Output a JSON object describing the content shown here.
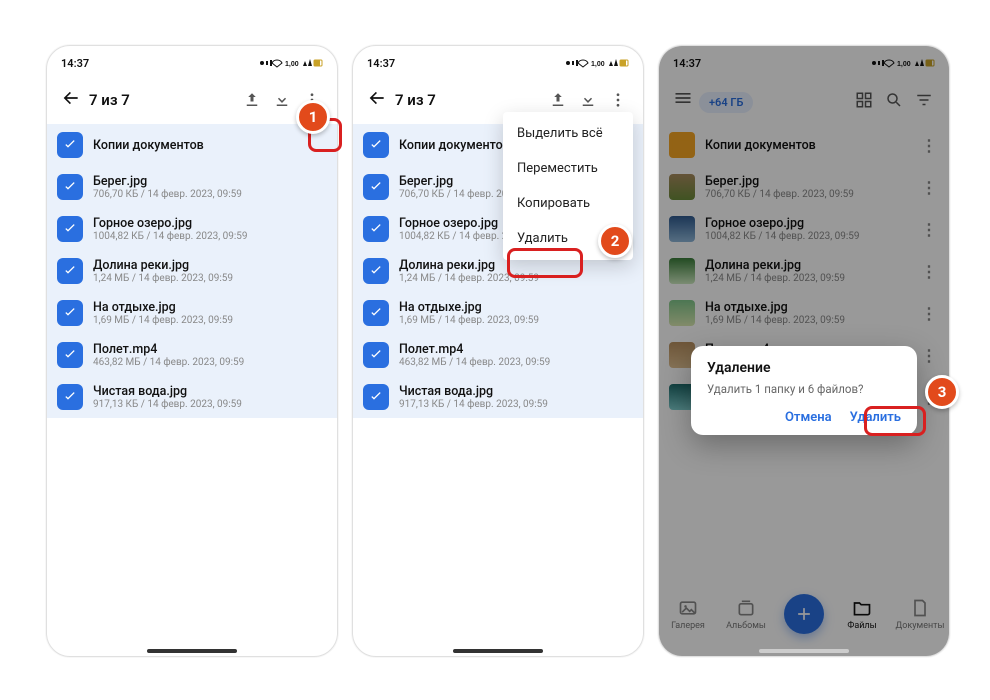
{
  "status_time": "14:37",
  "selection_title": "7 из 7",
  "chip_label": "+64 ГБ",
  "folder": {
    "name": "Копии документов"
  },
  "files": [
    {
      "name": "Берег.jpg",
      "meta": "706,70 КБ / 14 февр. 2023, 09:59",
      "thumb": "linear-gradient(#a88b5e,#6b8a3a)"
    },
    {
      "name": "Горное озеро.jpg",
      "meta": "1004,82 КБ / 14 февр. 2023, 09:59",
      "thumb": "linear-gradient(#2f5a8f,#8fb7d8)"
    },
    {
      "name": "Долина реки.jpg",
      "meta": "1,24 МБ / 14 февр. 2023, 09:59",
      "thumb": "linear-gradient(#3a7d3a,#cdeac0)"
    },
    {
      "name": "На отдыхе.jpg",
      "meta": "1,69 МБ / 14 февр. 2023, 09:59",
      "thumb": "linear-gradient(#7fc68a,#d9e8b0)"
    },
    {
      "name": "Полет.mp4",
      "meta": "463,82 МБ / 14 февр. 2023, 09:59",
      "thumb": "linear-gradient(#b89060,#e0c090)"
    },
    {
      "name": "Чистая вода.jpg",
      "meta": "917,13 КБ / 14 февр. 2023, 09:59",
      "thumb": "linear-gradient(#1e6b6b,#7fd0d0)"
    }
  ],
  "dropdown": {
    "select_all": "Выделить всё",
    "move": "Переместить",
    "copy": "Копировать",
    "delete": "Удалить"
  },
  "dialog": {
    "title": "Удаление",
    "message": "Удалить 1 папку и 6 файлов?",
    "cancel": "Отмена",
    "ok": "Удалить"
  },
  "nav": {
    "gallery": "Галерея",
    "albums": "Альбомы",
    "files": "Файлы",
    "docs": "Документы"
  },
  "badges": {
    "b1": "1",
    "b2": "2",
    "b3": "3"
  }
}
